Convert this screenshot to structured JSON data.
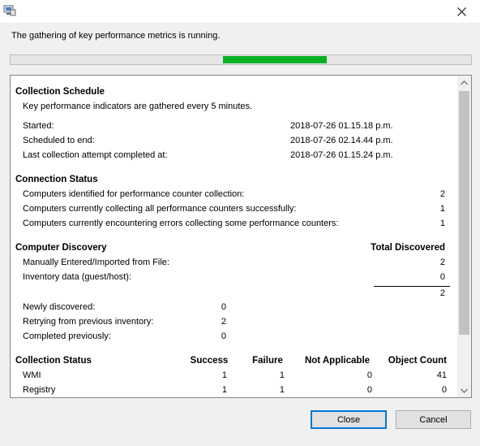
{
  "dialog": {
    "status_message": "The gathering of key performance metrics is running.",
    "progress_indicator": "marquee"
  },
  "collection_schedule": {
    "heading": "Collection Schedule",
    "description": "Key performance indicators are gathered every 5 minutes.",
    "rows": [
      {
        "label": "Started:",
        "value": "2018-07-26 01.15.18 p.m."
      },
      {
        "label": "Scheduled to end:",
        "value": "2018-07-26 02.14.44 p.m."
      },
      {
        "label": "Last collection attempt completed at:",
        "value": "2018-07-26 01.15.24 p.m."
      }
    ]
  },
  "connection_status": {
    "heading": "Connection Status",
    "rows": [
      {
        "label": "Computers identified for performance counter collection:",
        "value": "2"
      },
      {
        "label": "Computers currently collecting all performance counters successfully:",
        "value": "1"
      },
      {
        "label": "Computers currently encountering errors collecting some performance counters:",
        "value": "1"
      }
    ]
  },
  "computer_discovery": {
    "heading": "Computer Discovery",
    "total_header": "Total Discovered",
    "rows": [
      {
        "label": "Manually Entered/Imported from File:",
        "value": "2"
      },
      {
        "label": "Inventory data (guest/host):",
        "value": "0"
      }
    ],
    "total": "2",
    "status_rows": [
      {
        "label": "Newly discovered:",
        "value": "0"
      },
      {
        "label": "Retrying from previous inventory:",
        "value": "2"
      },
      {
        "label": "Completed previously:",
        "value": "0"
      }
    ]
  },
  "collection_status": {
    "heading": "Collection Status",
    "columns": [
      "Success",
      "Failure",
      "Not Applicable",
      "Object Count"
    ],
    "rows": [
      {
        "name": "WMI",
        "success": "1",
        "failure": "1",
        "not_applicable": "0",
        "object_count": "41"
      },
      {
        "name": "Registry",
        "success": "1",
        "failure": "1",
        "not_applicable": "0",
        "object_count": "0"
      }
    ]
  },
  "buttons": {
    "close": "Close",
    "cancel": "Cancel"
  },
  "colors": {
    "progress": "#06b025",
    "default_button_border": "#0078d7",
    "panel_border": "#828790"
  }
}
